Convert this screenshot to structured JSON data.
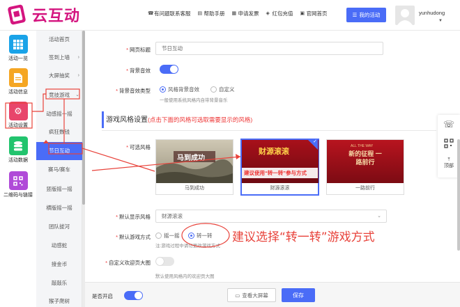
{
  "header": {
    "logo_text": "云互动",
    "nav": [
      {
        "label": "有问题联系客服",
        "icon": "headset-icon"
      },
      {
        "label": "帮助手册",
        "icon": "book-icon"
      },
      {
        "label": "申请发票",
        "icon": "invoice-icon"
      },
      {
        "label": "红包充值",
        "icon": "shield-icon"
      },
      {
        "label": "官网首页",
        "icon": "home-icon"
      }
    ],
    "my_activity": "我的活动",
    "username": "yunhudong"
  },
  "sidebar": {
    "items": [
      {
        "label": "活动一览",
        "icon": "grid-icon",
        "color": "#1aa3e8"
      },
      {
        "label": "活动信息",
        "icon": "document-icon",
        "color": "#f5a623"
      },
      {
        "label": "活动设置",
        "icon": "gear-icon",
        "color": "#e8456b"
      },
      {
        "label": "活动数据",
        "icon": "database-icon",
        "color": "#22c46e"
      },
      {
        "label": "二维码与链接",
        "icon": "qrcode-icon",
        "color": "#b04ad8"
      }
    ]
  },
  "subnav": {
    "items": [
      {
        "label": "活动首页"
      },
      {
        "label": "签到上墙",
        "caret": "›"
      },
      {
        "label": "大屏抽奖",
        "caret": "›"
      },
      {
        "label": "竞技游戏",
        "caret": "⌄"
      },
      {
        "label": "动感摇一摇"
      },
      {
        "label": "疯狂数钱"
      },
      {
        "label": "节日互动"
      },
      {
        "label": "赛马/赛车"
      },
      {
        "label": "竖版摇一摇"
      },
      {
        "label": "横版摇一摇"
      },
      {
        "label": "团队拔河"
      },
      {
        "label": "动感蛇"
      },
      {
        "label": "接金币"
      },
      {
        "label": "敲敲乐"
      },
      {
        "label": "猴子爬树"
      }
    ]
  },
  "form": {
    "page_title_label": "网页标题",
    "page_title_value": "节日互动",
    "bg_sound_label": "背景音效",
    "bg_sound_type_label": "背景音效类型",
    "bg_sound_type_options": [
      "风格背景音效",
      "自定义"
    ],
    "bg_sound_hint": "一般使用系统风格内自带背景音乐",
    "section_title": "游戏风格设置",
    "section_hint": "(点击下面的风格可选取需要显示的风格)",
    "styles_label": "可选风格",
    "styles": [
      {
        "caption": "马到成功",
        "thumb_text": "马到成功"
      },
      {
        "caption": "财源滚滚",
        "thumb_text": "财源滚滚",
        "overlay": "建议使用“转一转”参与方式"
      },
      {
        "caption": "一路前行",
        "thumb_text": "新的征程 一路前行",
        "thumb_sub": "ALL THE WAY"
      }
    ],
    "default_style_label": "默认显示风格",
    "default_style_value": "财源滚滚",
    "default_game_label": "默认游戏方式",
    "game_options": [
      "摇一摇",
      "转一转"
    ],
    "game_hint": "注:游戏过程中请勿更改游戏方式",
    "welcome_label": "自定义欢迎页大图",
    "welcome_hint": "默认使用风格内的欢迎页大图",
    "annotation": "建议选择“转一转”游戏方式"
  },
  "bottom": {
    "enabled_label": "是否开启",
    "preview": "查看大屏幕",
    "save": "保存"
  },
  "float": {
    "top_label": "顶部"
  }
}
